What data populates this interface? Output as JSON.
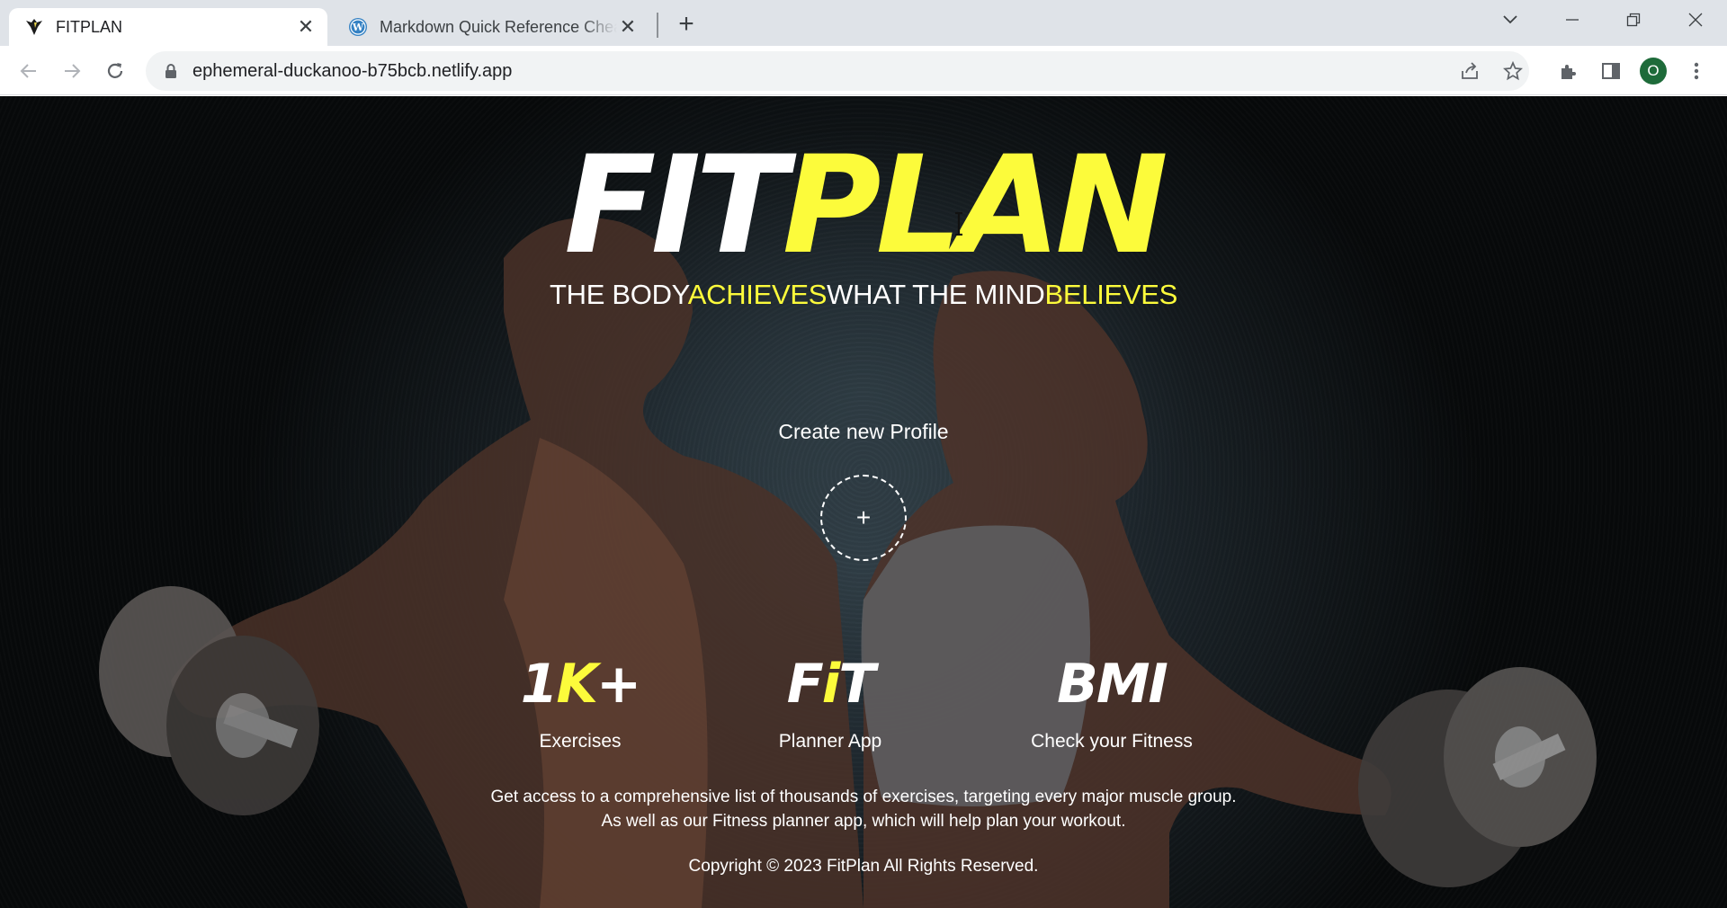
{
  "browser": {
    "tabs": [
      {
        "title": "FITPLAN",
        "favicon": "fitplan-icon",
        "active": true
      },
      {
        "title": "Markdown Quick Reference Cheat Sheet",
        "favicon": "wordpress-icon",
        "active": false
      }
    ],
    "url": "ephemeral-duckanoo-b75bcb.netlify.app",
    "profile_initial": "O"
  },
  "hero": {
    "logo_white": "FIT",
    "logo_yellow": "PLAN",
    "tagline": {
      "part1": "THE BODY",
      "part2": "ACHIEVES",
      "part3": "WHAT THE MIND",
      "part4": "BELIEVES"
    },
    "create_profile_label": "Create new Profile",
    "create_profile_icon": "plus-icon"
  },
  "stats": [
    {
      "big_a": "1",
      "big_b": "K",
      "big_c": "+",
      "label": "Exercises"
    },
    {
      "big_a": "F",
      "big_b": "i",
      "big_c": "T",
      "label": "Planner App"
    },
    {
      "big_a": "BMI",
      "big_b": "",
      "big_c": "",
      "label": "Check your Fitness"
    }
  ],
  "description": {
    "line1": "Get access to a comprehensive list of thousands of exercises, targeting every major muscle group.",
    "line2": "As well as our Fitness planner app, which will help plan your workout."
  },
  "footer": {
    "copyright": "Copyright © 2023 FitPlan All Rights Reserved."
  },
  "colors": {
    "accent": "#fcfb3b",
    "text": "#ffffff",
    "background": "#1e272d"
  }
}
